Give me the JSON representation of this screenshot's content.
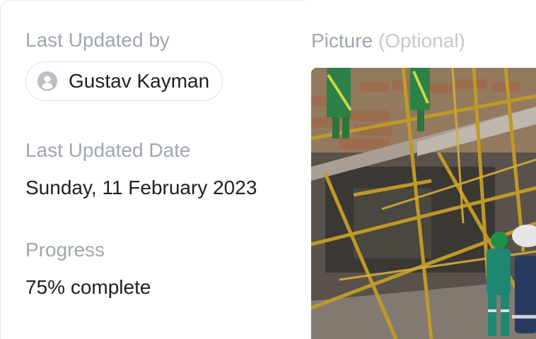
{
  "last_updated_by": {
    "label": "Last Updated by",
    "user_name": "Gustav Kayman",
    "avatar_icon": "user-avatar-icon"
  },
  "last_updated_date": {
    "label": "Last Updated Date",
    "value": "Sunday, 11 February 2023"
  },
  "progress": {
    "label": "Progress",
    "value": "75% complete",
    "percent": 75
  },
  "picture": {
    "label": "Picture",
    "optional_label": "(Optional)",
    "image_icon": "construction-scaffolding-photo"
  },
  "colors": {
    "label_gray": "#a0a6b1",
    "value_text": "#1c1f24",
    "chip_border": "#dcdfe4",
    "avatar_gray": "#b9bec7"
  }
}
